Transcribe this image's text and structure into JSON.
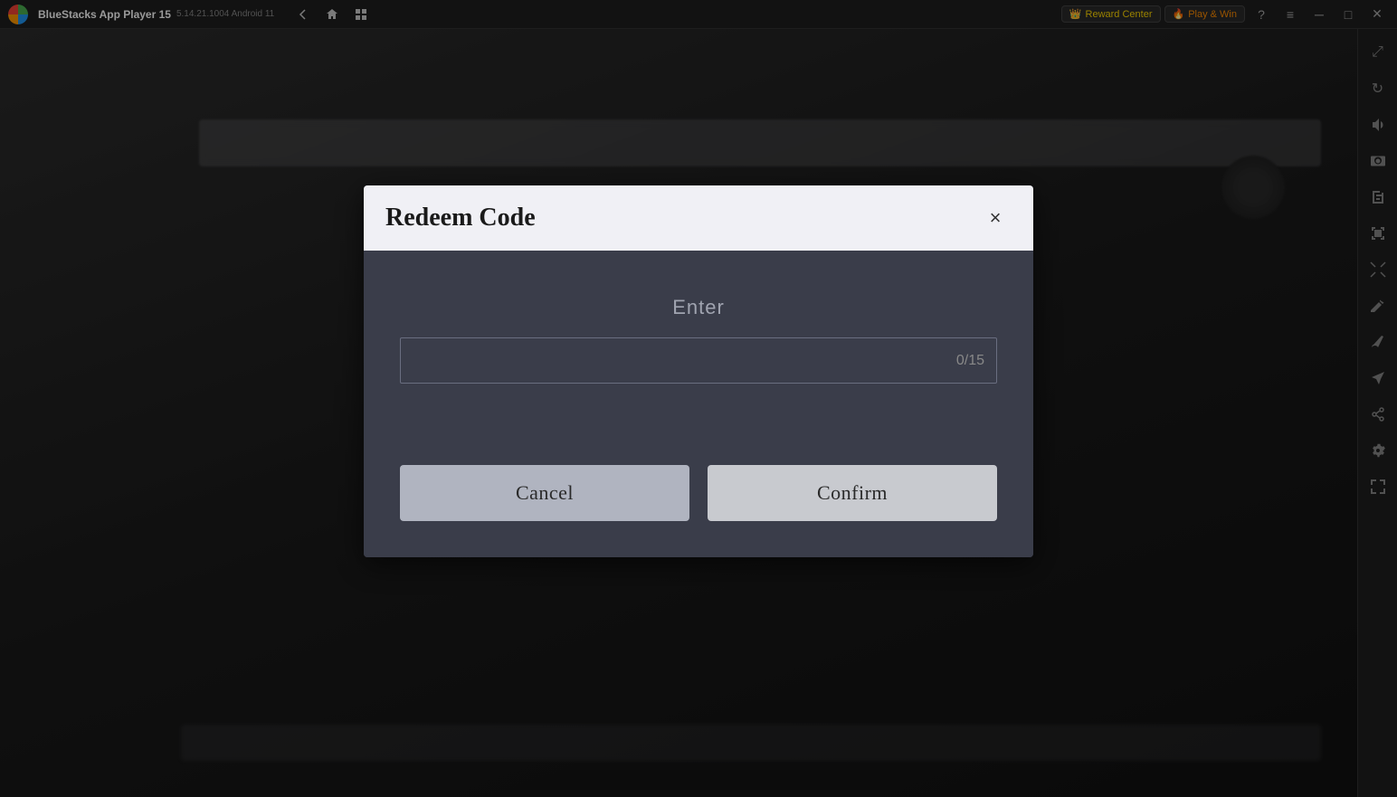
{
  "titlebar": {
    "app_name": "BlueStacks App Player 15",
    "version": "5.14.21.1004  Android 11",
    "reward_center_label": "Reward Center",
    "play_win_label": "Play & Win"
  },
  "dialog": {
    "title": "Redeem Code",
    "close_label": "×",
    "enter_label": "Enter",
    "code_counter": "0/15",
    "cancel_label": "Cancel",
    "confirm_label": "Confirm"
  },
  "sidebar": {
    "icons": [
      {
        "name": "expand-icon",
        "symbol": "⤢"
      },
      {
        "name": "rotate-icon",
        "symbol": "↻"
      },
      {
        "name": "volume-icon",
        "symbol": "🔊"
      },
      {
        "name": "camera-icon",
        "symbol": "📷"
      },
      {
        "name": "apk-icon",
        "symbol": "📦"
      },
      {
        "name": "screenshot-icon",
        "symbol": "🖼"
      },
      {
        "name": "zoom-icon",
        "symbol": "⤡"
      },
      {
        "name": "edit-icon",
        "symbol": "✏"
      },
      {
        "name": "brush-icon",
        "symbol": "🖌"
      },
      {
        "name": "plane-icon",
        "symbol": "✈"
      },
      {
        "name": "share-icon",
        "symbol": "↗"
      },
      {
        "name": "settings-icon",
        "symbol": "⚙"
      },
      {
        "name": "fullscreen-icon",
        "symbol": "⛶"
      }
    ]
  }
}
